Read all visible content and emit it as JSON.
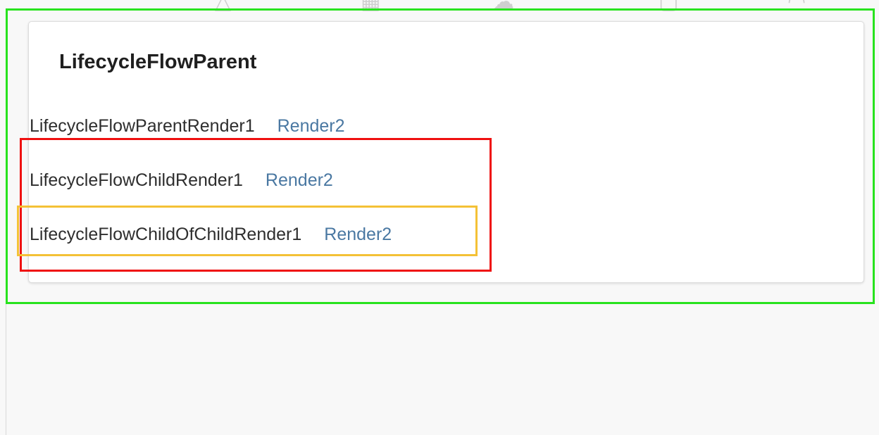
{
  "window": {
    "title": "LifecycleFlowParent"
  },
  "parent": {
    "label": "LifecycleFlowParentRender1",
    "link": "Render2"
  },
  "child": {
    "label": "LifecycleFlowChildRender1",
    "link": "Render2"
  },
  "child_of_child": {
    "label": "LifecycleFlowChildOfChildRender1",
    "link": "Render2"
  },
  "colors": {
    "outline_parent": "#28e31e",
    "outline_child": "#ef1010",
    "outline_child_of_child": "#f4c136",
    "link": "#4a78a2"
  }
}
